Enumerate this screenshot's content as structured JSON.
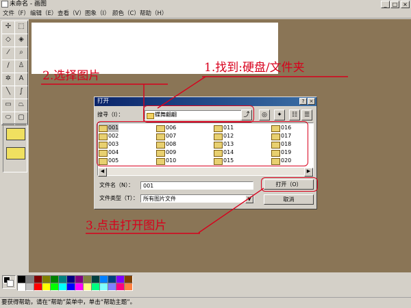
{
  "window": {
    "title": "未命名 - 画图",
    "buttons": {
      "minimize": "_",
      "maximize": "□",
      "close": "×"
    }
  },
  "menu": [
    "文件（F）",
    "编辑（E）",
    "查看（V）",
    "图象（I）",
    "颜色（C）",
    "帮助（H）"
  ],
  "tools": [
    {
      "name": "free-select",
      "glyph": "✢"
    },
    {
      "name": "select",
      "glyph": "⬚"
    },
    {
      "name": "eraser",
      "glyph": "◇"
    },
    {
      "name": "fill",
      "glyph": "◈"
    },
    {
      "name": "pick-color",
      "glyph": "⁄"
    },
    {
      "name": "magnifier",
      "glyph": "⌕"
    },
    {
      "name": "pencil",
      "glyph": "∕"
    },
    {
      "name": "brush",
      "glyph": "♙"
    },
    {
      "name": "airbrush",
      "glyph": "✲"
    },
    {
      "name": "text",
      "glyph": "A"
    },
    {
      "name": "line",
      "glyph": "╲"
    },
    {
      "name": "curve",
      "glyph": "∫"
    },
    {
      "name": "rectangle",
      "glyph": "▭"
    },
    {
      "name": "polygon",
      "glyph": "⏢"
    },
    {
      "name": "ellipse",
      "glyph": "⬭"
    },
    {
      "name": "rounded-rectangle",
      "glyph": "▢"
    }
  ],
  "palette": [
    "#000000",
    "#808080",
    "#800000",
    "#808000",
    "#008000",
    "#008080",
    "#000080",
    "#800080",
    "#808040",
    "#004040",
    "#0080ff",
    "#004080",
    "#8000ff",
    "#804000",
    "#ffffff",
    "#c0c0c0",
    "#ff0000",
    "#ffff00",
    "#00ff00",
    "#00ffff",
    "#0000ff",
    "#ff00ff",
    "#ffff80",
    "#00ff80",
    "#80ffff",
    "#8080ff",
    "#ff0080",
    "#ff8040"
  ],
  "status": "要获得帮助，请在“帮助”菜单中，单击“帮助主题”。",
  "dialog": {
    "title": "打开",
    "help_btn": "?",
    "close_btn": "×",
    "look_in_label": "搜寻（I）：",
    "look_in_value": "蝶舞翩翩",
    "filename_label": "文件名（N）：",
    "filename_value": "001",
    "filetype_label": "文件类型（T）：",
    "filetype_value": "所有图片文件",
    "open_button": "打开（O）",
    "cancel_button": "取消",
    "files": [
      "001",
      "002",
      "003",
      "004",
      "005",
      "006",
      "007",
      "008",
      "009",
      "010",
      "011",
      "012",
      "013",
      "014",
      "015",
      "016",
      "017",
      "018",
      "019",
      "020"
    ]
  },
  "annotations": {
    "step1": "1.找到:硬盘/文件夹",
    "step2": "2.选择图片",
    "step3": "3.点击打开图片"
  },
  "colors": {
    "annotation": "#d8001c",
    "workspace": "#8a7556",
    "titlebar": "#0a246a"
  }
}
